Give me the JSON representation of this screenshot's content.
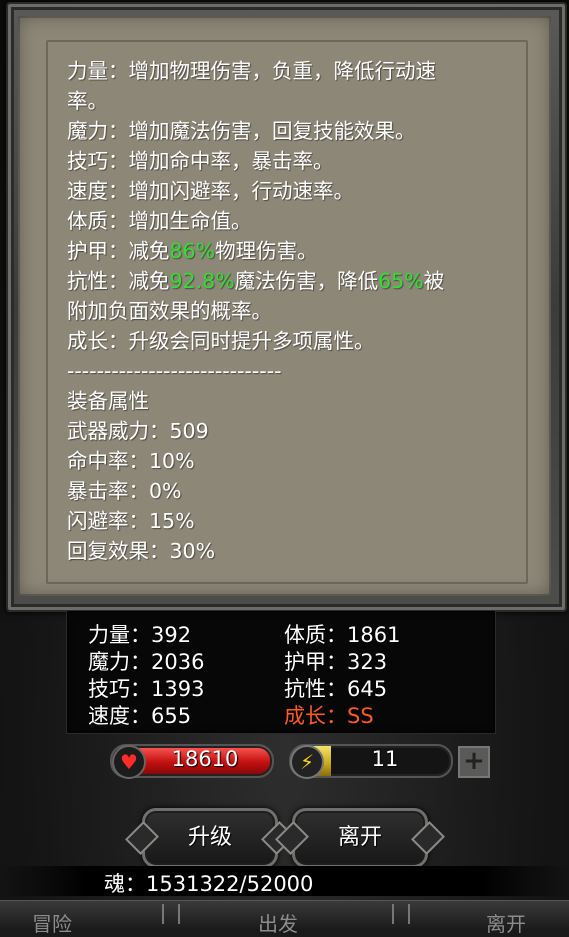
{
  "description_panel": {
    "lines": [
      {
        "segments": [
          {
            "text": "力量：增加物理伤害，负重，降低行动速"
          }
        ]
      },
      {
        "segments": [
          {
            "text": "率。"
          }
        ]
      },
      {
        "segments": [
          {
            "text": "魔力：增加魔法伤害，回复技能效果。"
          }
        ]
      },
      {
        "segments": [
          {
            "text": "技巧：增加命中率，暴击率。"
          }
        ]
      },
      {
        "segments": [
          {
            "text": "速度：增加闪避率，行动速率。"
          }
        ]
      },
      {
        "segments": [
          {
            "text": "体质：增加生命值。"
          }
        ]
      },
      {
        "segments": [
          {
            "text": "护甲：减免"
          },
          {
            "text": "86%",
            "color": "green"
          },
          {
            "text": "物理伤害。"
          }
        ]
      },
      {
        "segments": [
          {
            "text": "抗性：减免"
          },
          {
            "text": "92.8%",
            "color": "green"
          },
          {
            "text": "魔法伤害，降低"
          },
          {
            "text": "65%",
            "color": "green"
          },
          {
            "text": "被"
          }
        ]
      },
      {
        "segments": [
          {
            "text": "附加负面效果的概率。"
          }
        ]
      },
      {
        "segments": [
          {
            "text": "成长：升级会同时提升多项属性。"
          }
        ]
      },
      {
        "segments": [
          {
            "text": "-----------------------------"
          }
        ]
      },
      {
        "segments": [
          {
            "text": "装备属性"
          }
        ]
      },
      {
        "segments": [
          {
            "text": "武器威力：509"
          }
        ]
      },
      {
        "segments": [
          {
            "text": "命中率：10%"
          }
        ]
      },
      {
        "segments": [
          {
            "text": "暴击率：0%"
          }
        ]
      },
      {
        "segments": [
          {
            "text": "闪避率：15%"
          }
        ]
      },
      {
        "segments": [
          {
            "text": "回复效果：30%"
          }
        ]
      }
    ]
  },
  "stats": {
    "strength": "力量：392",
    "magic": "魔力：2036",
    "skill": "技巧：1393",
    "speed": "速度：655",
    "constitution": "体质：1861",
    "armor": "护甲：323",
    "resistance": "抗性：645",
    "growth": "成长：SS"
  },
  "hp": {
    "value": "18610",
    "icon": "heart-icon"
  },
  "energy": {
    "value": "11",
    "icon": "lightning-icon",
    "fill_fraction": 0.25
  },
  "plus_label": "+",
  "buttons": {
    "upgrade": "升级",
    "leave": "离开"
  },
  "soul": "魂：1531322/52000",
  "bottom_nav": {
    "left": "冒险",
    "middle": "出发",
    "right": "离开"
  },
  "colors": {
    "green": "#2fe02f",
    "growth_orange": "#ff5a1e",
    "panel": "#8d8778"
  }
}
